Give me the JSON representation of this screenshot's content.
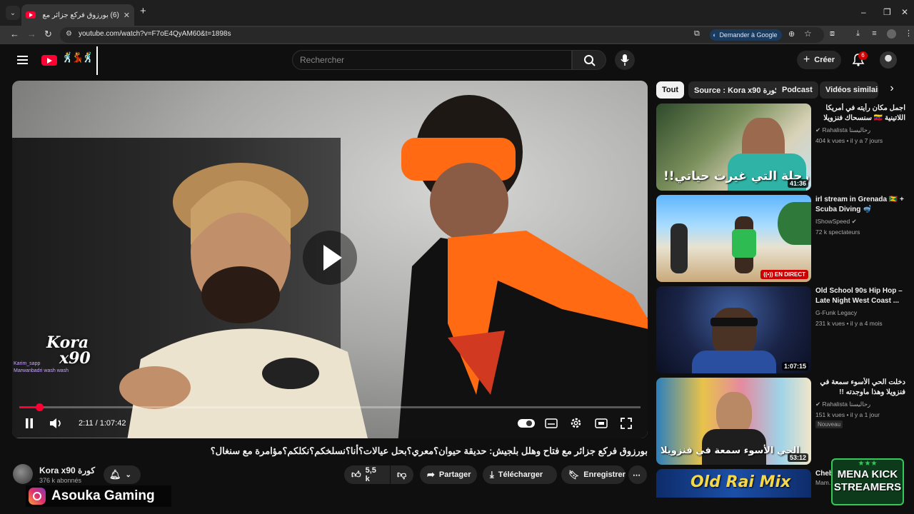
{
  "browser": {
    "tab_title": "(6) بورزوق فركع جزائر مع فتاح",
    "url": "youtube.com/watch?v=F7oE4QyAM60&t=1898s",
    "ask_google_label": "Demander à Google"
  },
  "masthead": {
    "search_placeholder": "Rechercher",
    "create_label": "Créer",
    "notification_count": "6"
  },
  "player": {
    "time": "2:11 / 1:07:42",
    "progress_fraction": 0.032,
    "watermark_title": "Kora",
    "watermark_sub": "x90",
    "watermark_names": "Karim_sapp\nMarwanbadri wash wash"
  },
  "video": {
    "title": "بورزوق فركع جزائر مع فتاح وهلل بلجيش: حديقة حيوان؟معري؟بحل عيالات؟أنا؟نسلخكم؟نكلكم؟مؤامرة مع سنغال؟",
    "channel_name": "Kora x90 كورة",
    "subscribers": "376 k abonnés",
    "likes": "5,5 k",
    "share_label": "Partager",
    "download_label": "Télécharger",
    "save_label": "Enregistrer"
  },
  "chips": [
    "Tout",
    "Source : Kora x90 كورة",
    "Podcast",
    "Vidéos similaires"
  ],
  "recommendations": [
    {
      "title": "اجمل مكان رأيته في أمريكا اللاتينية 🇻🇪 سنسحاك فنزويلا",
      "channel": "Rahalista رحاليستا",
      "meta": "404 k vues • il y a 7 jours",
      "duration": "41:36",
      "thumb_text": "!!رحلة التي غيرت حياتي"
    },
    {
      "title": "irl stream in Grenada 🇬🇩 + Scuba Diving 🤿",
      "channel": "IShowSpeed",
      "meta": "72 k spectateurs",
      "live_label": "EN DIRECT"
    },
    {
      "title": "Old School 90s Hip Hop – Late Night West Coast ...",
      "channel": "G-Funk Legacy",
      "meta": "231 k vues • il y a 4 mois",
      "duration": "1:07:15"
    },
    {
      "title": "دخلت الحي الأسوء سمعة في فنزويلا وهذا ماوجدته !!",
      "channel": "Rahalista رحاليستا",
      "meta": "151 k vues • il y a 1 jour",
      "badge": "Nouveau",
      "duration": "53:12",
      "thumb_text": "الحي الأسوء سمعة في فنزويلا"
    },
    {
      "title": "Cheb...",
      "channel": "Mam...",
      "thumb_text": "Old Rai Mix"
    }
  ],
  "overlays": {
    "instagram_handle": "Asouka Gaming",
    "mena_line1": "MENA KICK",
    "mena_line2": "STREAMERS"
  },
  "colors": {
    "accent": "#ff0033",
    "background": "#0f0f0f"
  }
}
